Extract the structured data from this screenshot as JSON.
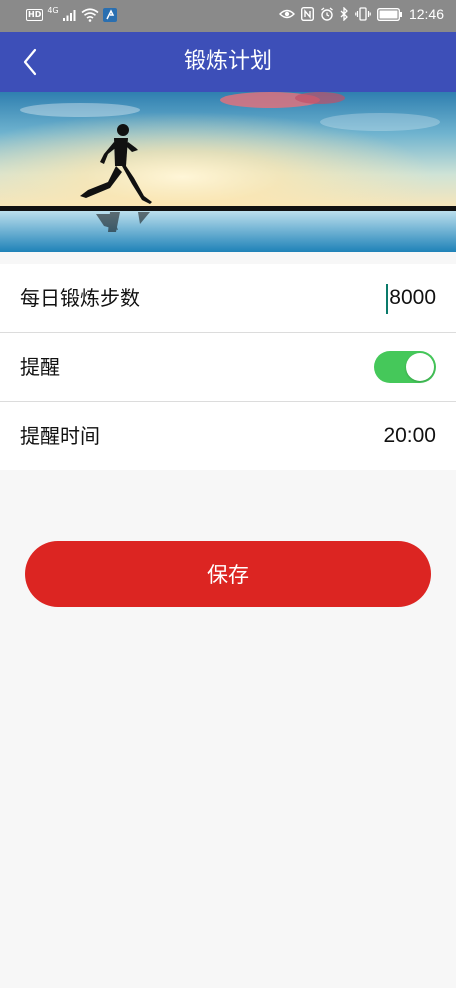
{
  "status_bar": {
    "hd_label": "HD",
    "network_label": "4G",
    "time": "12:46"
  },
  "nav": {
    "title": "锻炼计划"
  },
  "settings": {
    "steps": {
      "label": "每日锻炼步数",
      "value": "8000"
    },
    "reminder": {
      "label": "提醒",
      "enabled": true
    },
    "reminder_time": {
      "label": "提醒时间",
      "value": "20:00"
    }
  },
  "save_button": {
    "label": "保存"
  },
  "colors": {
    "nav_bar": "#3d4fb8",
    "toggle_on": "#45c85a",
    "save_button": "#dc2522",
    "status_bar": "#8a8a8a"
  }
}
